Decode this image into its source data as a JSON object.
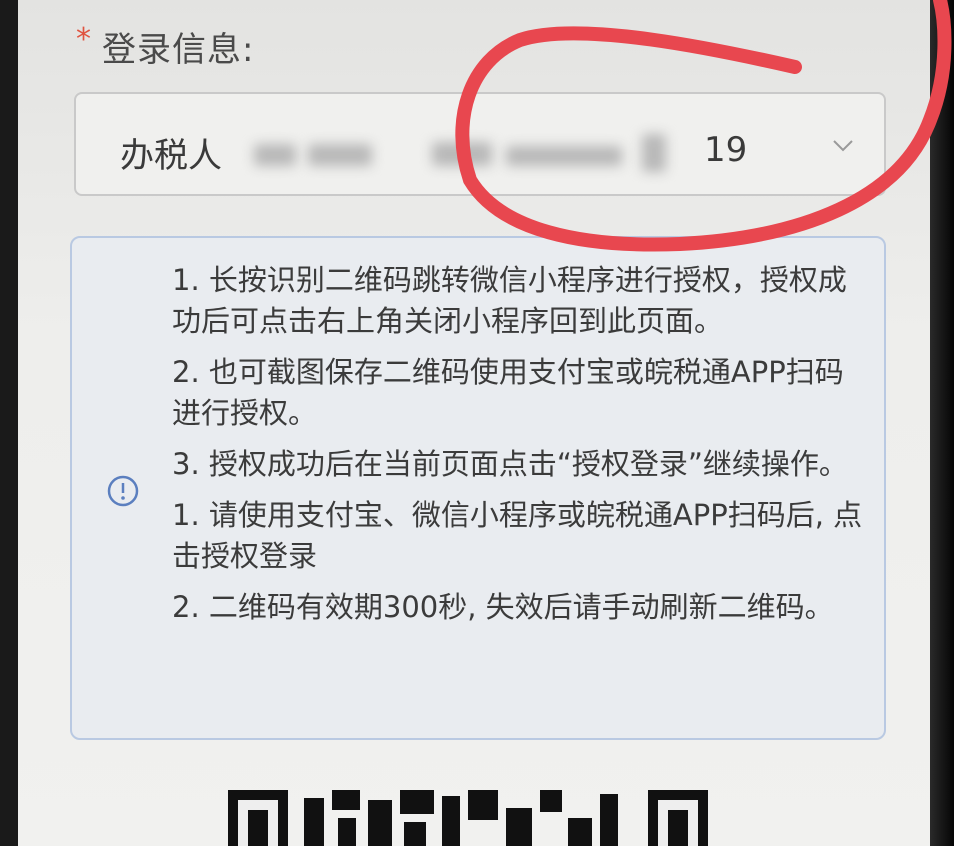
{
  "form": {
    "required_mark": "*",
    "label": "登录信息:",
    "select": {
      "prefix": "办税人",
      "suffix": "19"
    }
  },
  "info": {
    "paragraphs": [
      "1. 长按识别二维码跳转微信小程序进行授权，授权成功后可点击右上角关闭小程序回到此页面。",
      "2. 也可截图保存二维码使用支付宝或皖税通APP扫码进行授权。",
      "3. 授权成功后在当前页面点击“授权登录”继续操作。",
      "1. 请使用支付宝、微信小程序或皖税通APP扫码后, 点击授权登录",
      "2. 二维码有效期300秒, 失效后请手动刷新二维码。"
    ]
  },
  "colors": {
    "required": "#e0533f",
    "info_border": "#b9c9e2",
    "info_icon": "#5b7fbf",
    "annotation_red": "#e8474f"
  },
  "icons": {
    "info": "info-circle-icon",
    "dropdown": "chevron-down-icon"
  }
}
